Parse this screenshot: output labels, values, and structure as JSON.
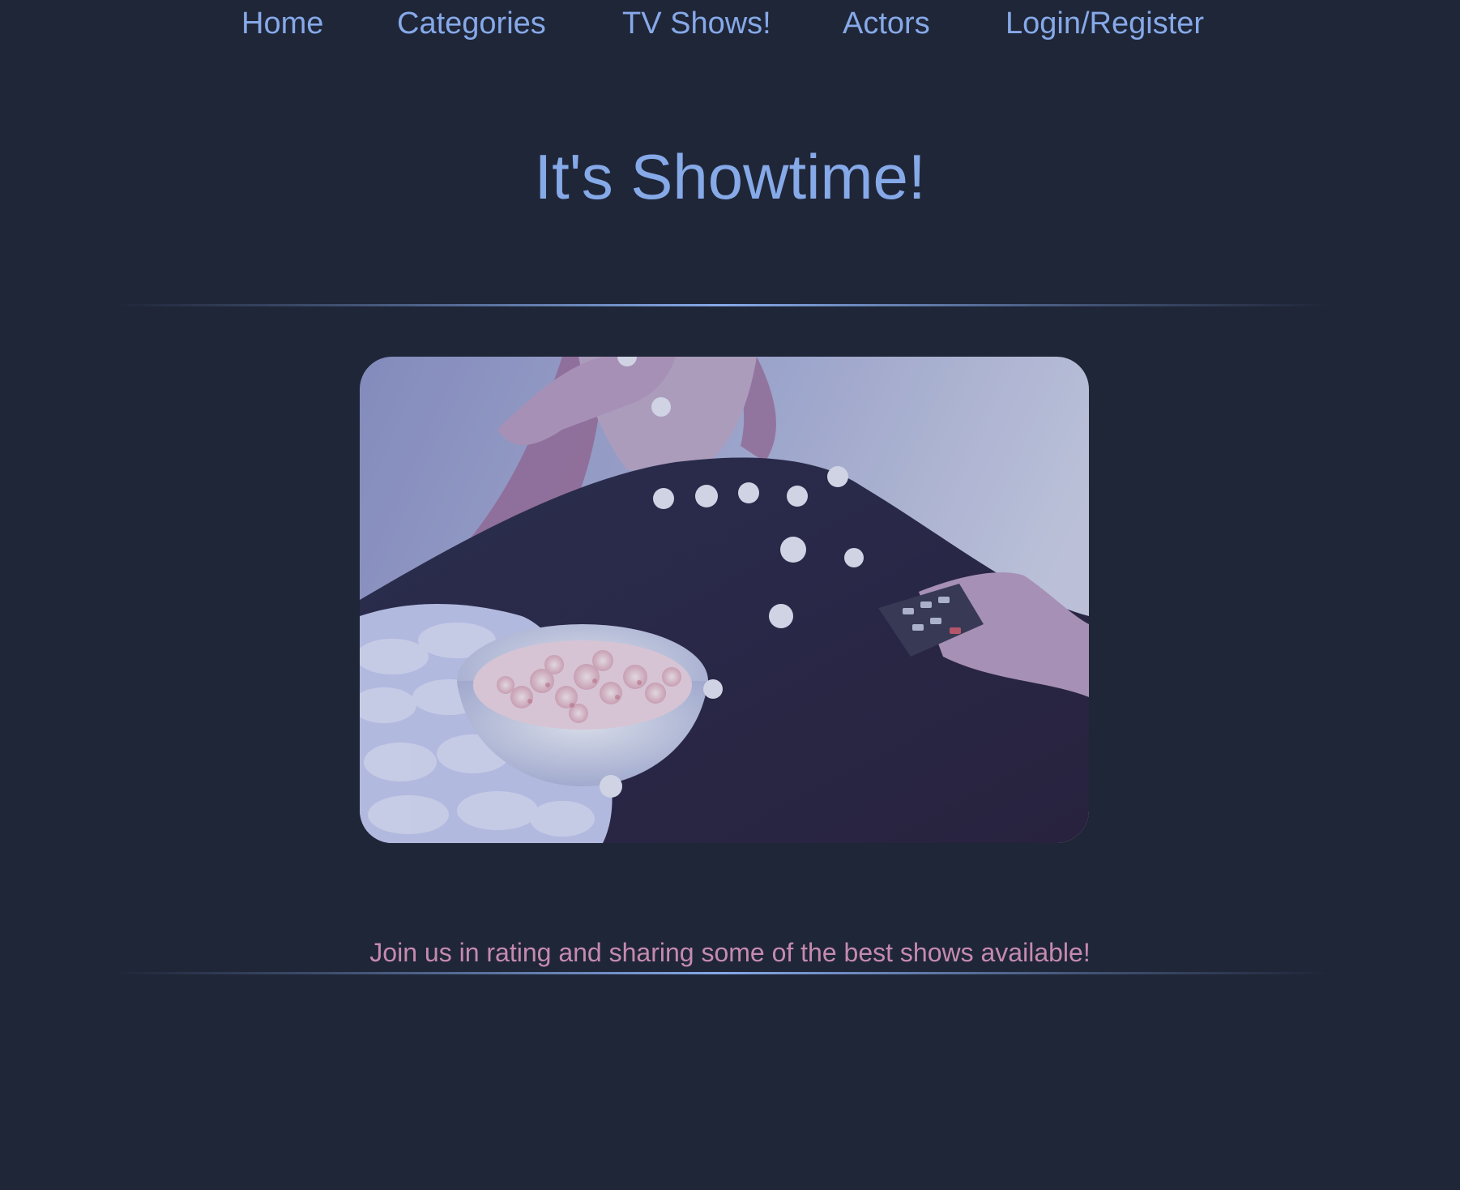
{
  "nav": {
    "items": [
      {
        "label": "Home"
      },
      {
        "label": "Categories"
      },
      {
        "label": "TV Shows!"
      },
      {
        "label": "Actors"
      },
      {
        "label": "Login/Register"
      }
    ]
  },
  "hero": {
    "title": "It's Showtime!",
    "image_subject": "person on couch eating popcorn holding TV remote"
  },
  "tagline": "Join us in rating and sharing some of the best shows available!",
  "colors": {
    "background": "#1f2638",
    "link": "#86a9e8",
    "tagline": "#c58ab0"
  }
}
